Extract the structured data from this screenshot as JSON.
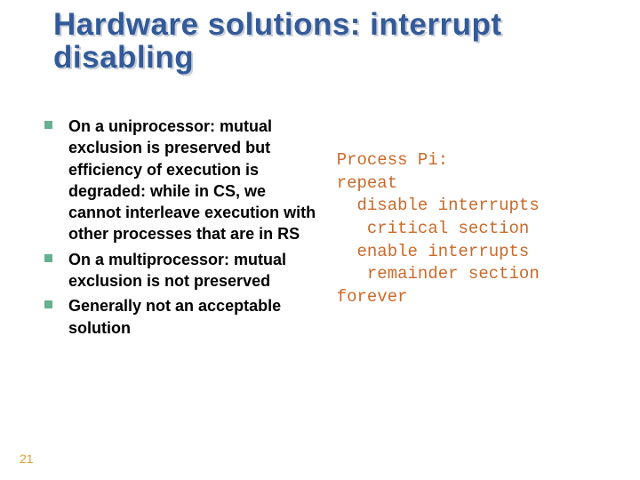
{
  "slide": {
    "title": "Hardware solutions: interrupt disabling",
    "page_number": "21",
    "bullets": [
      "On a uniprocessor: mutual exclusion is preserved but efficiency of execution is degraded: while in CS, we cannot interleave execution with other processes that are in RS",
      "On a multiprocessor: mutual exclusion is not preserved",
      "Generally not an acceptable solution"
    ],
    "code": "Process Pi:\nrepeat\n  disable interrupts\n   critical section\n  enable interrupts\n   remainder section\nforever"
  },
  "colors": {
    "title_front": "#335a99",
    "title_shadow": "#c9cfd8",
    "bullet_marker": "#66b090",
    "code_text": "#c96a2a",
    "page_num": "#d4a030"
  }
}
